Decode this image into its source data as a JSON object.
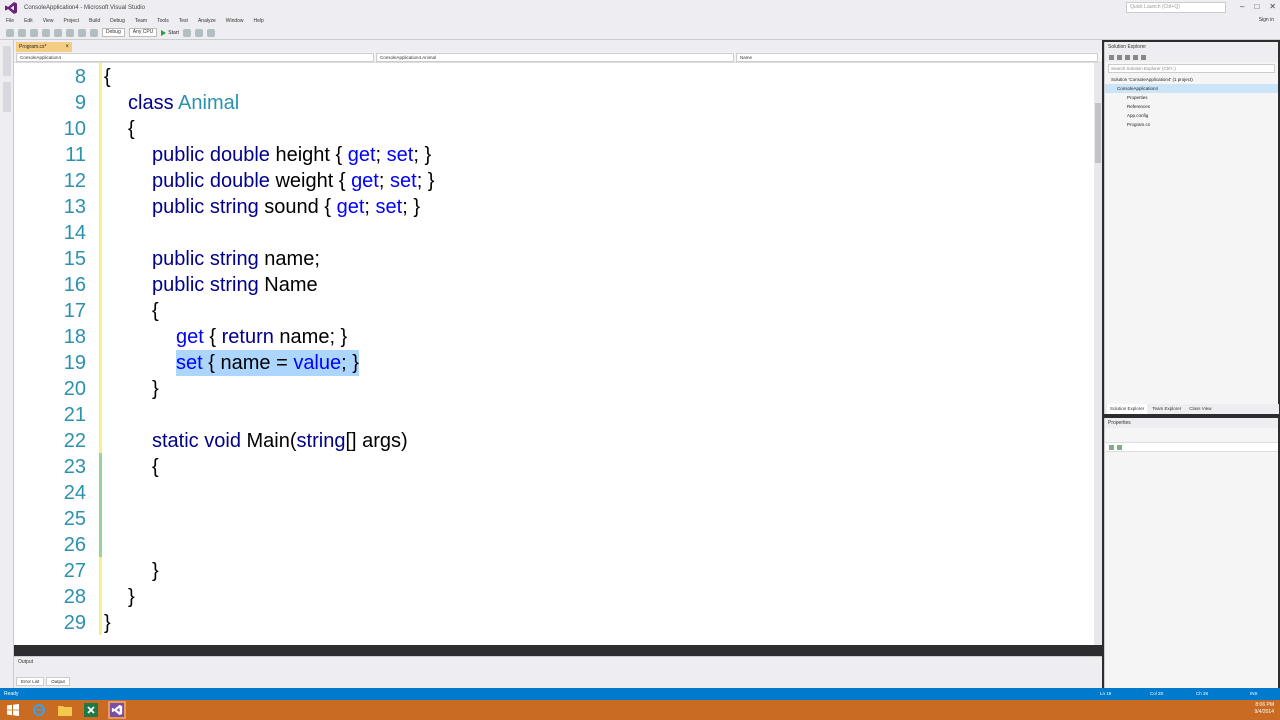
{
  "window": {
    "title": "ConsoleApplication4 - Microsoft Visual Studio",
    "quick_launch_placeholder": "Quick Launch (Ctrl+Q)",
    "sign_in": "Sign in",
    "controls": {
      "minimize": "–",
      "maximize": "□",
      "close": "✕"
    }
  },
  "menu": [
    "File",
    "Edit",
    "View",
    "Project",
    "Build",
    "Debug",
    "Team",
    "Tools",
    "Test",
    "Analyze",
    "Window",
    "Help"
  ],
  "toolbar": {
    "config": "Debug",
    "platform": "Any CPU",
    "start_label": "Start"
  },
  "document": {
    "tab_label": "Program.cs*",
    "nav_left": "ConsoleApplication4",
    "nav_middle": "ConsoleApplication4.Animal",
    "nav_right": "Name"
  },
  "code_lines": [
    {
      "n": "8",
      "indent": 0,
      "tokens": [
        [
          "p",
          "{"
        ]
      ]
    },
    {
      "n": "9",
      "indent": 1,
      "tokens": [
        [
          "kw2",
          "class"
        ],
        [
          "p",
          " "
        ],
        [
          "type",
          "Animal"
        ]
      ]
    },
    {
      "n": "10",
      "indent": 1,
      "tokens": [
        [
          "p",
          "{"
        ]
      ]
    },
    {
      "n": "11",
      "indent": 2,
      "tokens": [
        [
          "kw2",
          "public"
        ],
        [
          "p",
          " "
        ],
        [
          "kw2",
          "double"
        ],
        [
          "p",
          " height { "
        ],
        [
          "kw",
          "get"
        ],
        [
          "p",
          "; "
        ],
        [
          "kw",
          "set"
        ],
        [
          "p",
          "; }"
        ]
      ]
    },
    {
      "n": "12",
      "indent": 2,
      "tokens": [
        [
          "kw2",
          "public"
        ],
        [
          "p",
          " "
        ],
        [
          "kw2",
          "double"
        ],
        [
          "p",
          " weight { "
        ],
        [
          "kw",
          "get"
        ],
        [
          "p",
          "; "
        ],
        [
          "kw",
          "set"
        ],
        [
          "p",
          "; }"
        ]
      ]
    },
    {
      "n": "13",
      "indent": 2,
      "tokens": [
        [
          "kw2",
          "public"
        ],
        [
          "p",
          " "
        ],
        [
          "kw2",
          "string"
        ],
        [
          "p",
          " sound { "
        ],
        [
          "kw",
          "get"
        ],
        [
          "p",
          "; "
        ],
        [
          "kw",
          "set"
        ],
        [
          "p",
          "; }"
        ]
      ]
    },
    {
      "n": "14",
      "indent": 0,
      "tokens": []
    },
    {
      "n": "15",
      "indent": 2,
      "tokens": [
        [
          "kw2",
          "public"
        ],
        [
          "p",
          " "
        ],
        [
          "kw2",
          "string"
        ],
        [
          "p",
          " name;"
        ]
      ]
    },
    {
      "n": "16",
      "indent": 2,
      "tokens": [
        [
          "kw2",
          "public"
        ],
        [
          "p",
          " "
        ],
        [
          "kw2",
          "string"
        ],
        [
          "p",
          " Name"
        ]
      ]
    },
    {
      "n": "17",
      "indent": 2,
      "tokens": [
        [
          "p",
          "{"
        ]
      ]
    },
    {
      "n": "18",
      "indent": 3,
      "tokens": [
        [
          "kw",
          "get"
        ],
        [
          "p",
          " { "
        ],
        [
          "kw2",
          "return"
        ],
        [
          "p",
          " name; }"
        ]
      ]
    },
    {
      "n": "19",
      "indent": 3,
      "selected": true,
      "tokens": [
        [
          "kw",
          "set"
        ],
        [
          "p",
          " { name = "
        ],
        [
          "kw",
          "value"
        ],
        [
          "p",
          "; }"
        ]
      ]
    },
    {
      "n": "20",
      "indent": 2,
      "tokens": [
        [
          "p",
          "}"
        ]
      ]
    },
    {
      "n": "21",
      "indent": 0,
      "tokens": []
    },
    {
      "n": "22",
      "indent": 2,
      "tokens": [
        [
          "kw2",
          "static"
        ],
        [
          "p",
          " "
        ],
        [
          "kw2",
          "void"
        ],
        [
          "p",
          " Main("
        ],
        [
          "kw2",
          "string"
        ],
        [
          "p",
          "[] args)"
        ]
      ]
    },
    {
      "n": "23",
      "indent": 2,
      "tokens": [
        [
          "p",
          "{"
        ]
      ]
    },
    {
      "n": "24",
      "indent": 0,
      "tokens": []
    },
    {
      "n": "25",
      "indent": 0,
      "tokens": []
    },
    {
      "n": "26",
      "indent": 0,
      "tokens": []
    },
    {
      "n": "27",
      "indent": 2,
      "tokens": [
        [
          "p",
          "}"
        ]
      ]
    },
    {
      "n": "28",
      "indent": 1,
      "tokens": [
        [
          "p",
          "}"
        ]
      ]
    },
    {
      "n": "29",
      "indent": 0,
      "tokens": [
        [
          "p",
          "}"
        ]
      ]
    }
  ],
  "output_panel": {
    "title": "Output",
    "tabs": [
      "Error List",
      "Output"
    ]
  },
  "solution_explorer": {
    "title": "Solution Explorer",
    "search_placeholder": "Search Solution Explorer (Ctrl+;)",
    "tree": [
      "Solution 'ConsoleApplication4' (1 project)",
      "ConsoleApplication4",
      "Properties",
      "References",
      "App.config",
      "Program.cs"
    ],
    "bottom_tabs": [
      "Solution Explorer",
      "Team Explorer",
      "Class View"
    ]
  },
  "properties": {
    "title": "Properties"
  },
  "status": {
    "text": "Ready",
    "line": "Ln 19",
    "col": "Col 28",
    "ch": "Ch 28",
    "ins": "INS"
  },
  "taskbar": {
    "time": "8:06 PM",
    "date": "9/4/2014"
  }
}
